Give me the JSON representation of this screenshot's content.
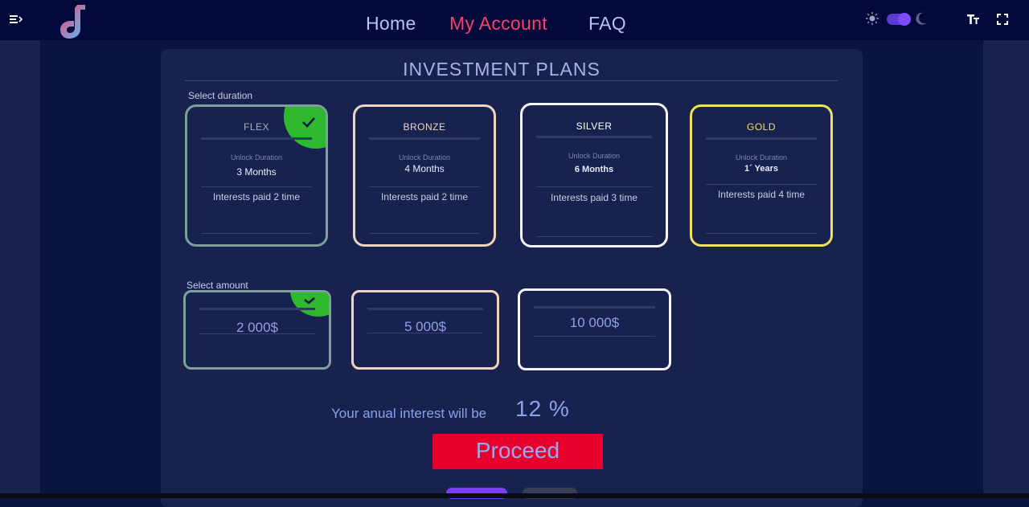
{
  "nav": {
    "home": "Home",
    "my_account": "My Account",
    "faq": "FAQ",
    "active": "my_account"
  },
  "theme": {
    "active_nav_color": "#ff3d6b",
    "selected_badge_color": "#2eb82e",
    "proceed_color": "#e8002c"
  },
  "icons": {
    "menu": "menu-collapse-icon",
    "logo": "music-note-logo",
    "sun": "sun-icon",
    "moon": "moon-icon",
    "text_size": "text-size-icon",
    "fullscreen": "fullscreen-icon"
  },
  "theme_toggle": {
    "state": "on"
  },
  "page": {
    "title": "INVESTMENT PLANS",
    "select_duration_label": "Select duration",
    "select_amount_label": "Select amount"
  },
  "plans": [
    {
      "name": "FLEX",
      "unlock_label": "Unlock Duration",
      "unlock_value": "3 Months",
      "interest": "Interests paid 2 time",
      "selected": true,
      "border_color": "#7da09a"
    },
    {
      "name": "BRONZE",
      "unlock_label": "Unlock Duration",
      "unlock_value": "4 Months",
      "interest": "Interests paid 2 time",
      "selected": false,
      "border_color": "#f0d4be"
    },
    {
      "name": "SILVER",
      "unlock_label": "Unlock Duration",
      "unlock_value": "6 Months",
      "interest": "Interests paid 3 time",
      "selected": false,
      "border_color": "#f5f5ff"
    },
    {
      "name": "GOLD",
      "unlock_label": "Unlock Duration",
      "unlock_value": "1´ Years",
      "interest": "Interests paid 4 time",
      "selected": false,
      "border_color": "#f0e060"
    }
  ],
  "amounts": [
    {
      "value": "2 000$",
      "selected": true
    },
    {
      "value": "5 000$",
      "selected": false
    },
    {
      "value": "10 000$",
      "selected": false
    }
  ],
  "summary": {
    "text": "Your anual interest will be",
    "value": "12 %"
  },
  "proceed_label": "Proceed"
}
